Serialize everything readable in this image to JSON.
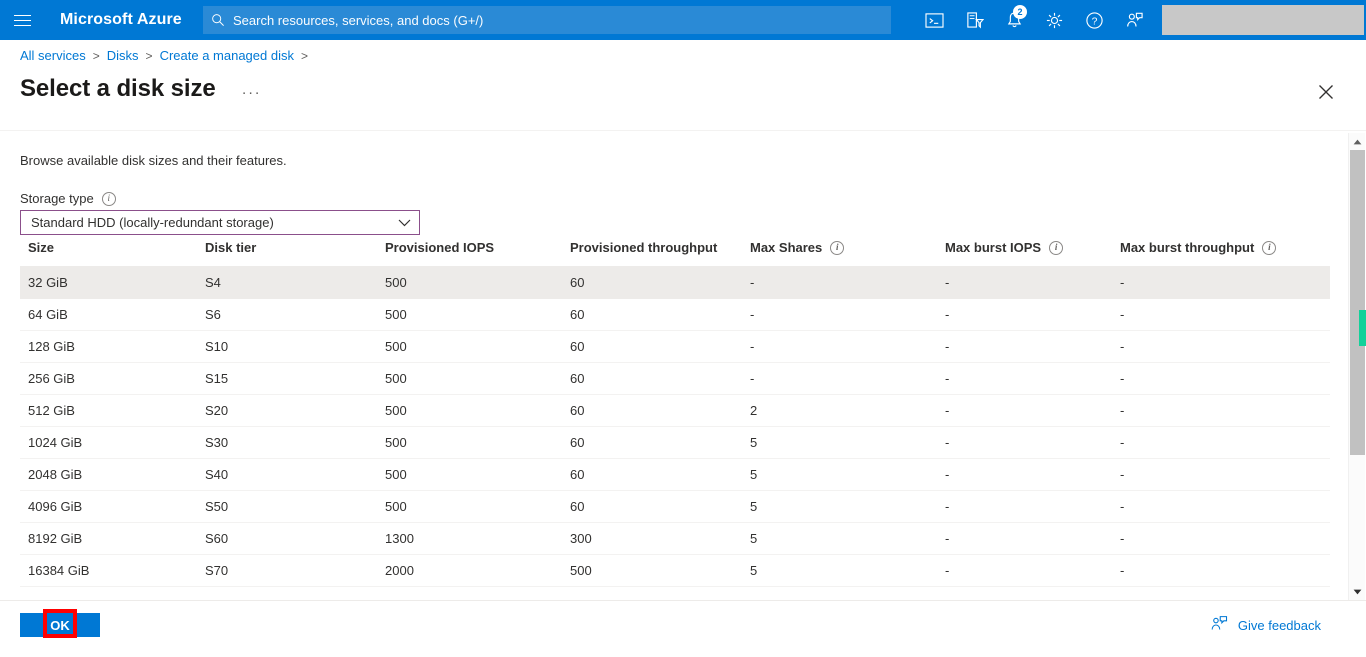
{
  "topbar": {
    "menu_icon": "hamburger-icon",
    "brand": "Microsoft Azure",
    "search": {
      "placeholder": "Search resources, services, and docs (G+/)",
      "value": "",
      "icon": "search-icon"
    },
    "icons": [
      {
        "name": "cloud-shell-icon",
        "label": "Cloud Shell"
      },
      {
        "name": "directories-filter-icon",
        "label": "Directories + subscriptions"
      },
      {
        "name": "notifications-bell-icon",
        "label": "Notifications",
        "badge": "2"
      },
      {
        "name": "settings-gear-icon",
        "label": "Settings"
      },
      {
        "name": "help-question-icon",
        "label": "Help"
      },
      {
        "name": "feedback-person-icon",
        "label": "Feedback"
      }
    ],
    "account_redacted": ""
  },
  "breadcrumb": {
    "items": [
      {
        "label": "All services"
      },
      {
        "label": "Disks"
      },
      {
        "label": "Create a managed disk"
      }
    ],
    "separator": ">"
  },
  "page": {
    "title": "Select a disk size",
    "ellipsis": "···",
    "close_icon": "close-icon",
    "subtitle": "Browse available disk sizes and their features."
  },
  "storage_type": {
    "label": "Storage type",
    "info_icon": "info-icon",
    "value": "Standard HDD (locally-redundant storage)",
    "chevron_icon": "chevron-down-icon",
    "border_color": "#8b4f8b"
  },
  "table": {
    "columns": [
      {
        "key": "size",
        "label": "Size",
        "info": false
      },
      {
        "key": "tier",
        "label": "Disk tier",
        "info": false
      },
      {
        "key": "piops",
        "label": "Provisioned IOPS",
        "info": false
      },
      {
        "key": "pthru",
        "label": "Provisioned throughput",
        "info": false
      },
      {
        "key": "shares",
        "label": "Max Shares",
        "info": true
      },
      {
        "key": "biops",
        "label": "Max burst IOPS",
        "info": true
      },
      {
        "key": "bthru",
        "label": "Max burst throughput",
        "info": true
      }
    ],
    "rows": [
      {
        "size": "32 GiB",
        "tier": "S4",
        "piops": "500",
        "pthru": "60",
        "shares": "-",
        "biops": "-",
        "bthru": "-",
        "selected": true
      },
      {
        "size": "64 GiB",
        "tier": "S6",
        "piops": "500",
        "pthru": "60",
        "shares": "-",
        "biops": "-",
        "bthru": "-",
        "selected": false
      },
      {
        "size": "128 GiB",
        "tier": "S10",
        "piops": "500",
        "pthru": "60",
        "shares": "-",
        "biops": "-",
        "bthru": "-",
        "selected": false
      },
      {
        "size": "256 GiB",
        "tier": "S15",
        "piops": "500",
        "pthru": "60",
        "shares": "-",
        "biops": "-",
        "bthru": "-",
        "selected": false
      },
      {
        "size": "512 GiB",
        "tier": "S20",
        "piops": "500",
        "pthru": "60",
        "shares": "2",
        "biops": "-",
        "bthru": "-",
        "selected": false
      },
      {
        "size": "1024 GiB",
        "tier": "S30",
        "piops": "500",
        "pthru": "60",
        "shares": "5",
        "biops": "-",
        "bthru": "-",
        "selected": false
      },
      {
        "size": "2048 GiB",
        "tier": "S40",
        "piops": "500",
        "pthru": "60",
        "shares": "5",
        "biops": "-",
        "bthru": "-",
        "selected": false
      },
      {
        "size": "4096 GiB",
        "tier": "S50",
        "piops": "500",
        "pthru": "60",
        "shares": "5",
        "biops": "-",
        "bthru": "-",
        "selected": false
      },
      {
        "size": "8192 GiB",
        "tier": "S60",
        "piops": "1300",
        "pthru": "300",
        "shares": "5",
        "biops": "-",
        "bthru": "-",
        "selected": false
      },
      {
        "size": "16384 GiB",
        "tier": "S70",
        "piops": "2000",
        "pthru": "500",
        "shares": "5",
        "biops": "-",
        "bthru": "-",
        "selected": false
      }
    ]
  },
  "scrollbar": {
    "up_icon": "scroll-up-arrow-icon",
    "down_icon": "scroll-down-arrow-icon",
    "marker_color": "#13d19a"
  },
  "footer": {
    "ok_label": "OK",
    "give_feedback_label": "Give feedback",
    "give_feedback_icon": "feedback-person-icon",
    "highlight_color": "#ff0000"
  }
}
